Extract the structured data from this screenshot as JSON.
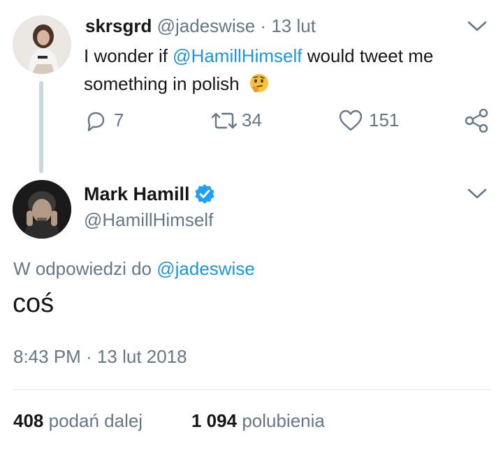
{
  "reply_tweet": {
    "display_name": "skrsgrd",
    "handle": "@jadeswise",
    "separator": "·",
    "date": "13 lut",
    "text_before": "I wonder if ",
    "mention": "@HamillHimself",
    "text_after_line1": " would tweet me",
    "text_line2": "something in polish",
    "emoji": "🤔",
    "counts": {
      "replies": "7",
      "retweets": "34",
      "likes": "151"
    }
  },
  "main_tweet": {
    "display_name": "Mark Hamill",
    "handle": "@HamillHimself",
    "verified": true,
    "reply_to_label": "W odpowiedzi do",
    "reply_to_handle": "@jadeswise",
    "text": "coś",
    "timestamp": "8:43 PM · 13 lut 2018",
    "retweets_count": "408",
    "retweets_label": "podań dalej",
    "likes_count": "1 094",
    "likes_label": "polubienia"
  },
  "colors": {
    "link": "#1b95e0",
    "muted": "#657786",
    "thread_line": "#ccd6dd",
    "verified": "#1da1f2"
  },
  "icons": [
    "reply-icon",
    "retweet-icon",
    "like-icon",
    "share-icon",
    "chevron-down-icon",
    "verified-badge-icon"
  ]
}
